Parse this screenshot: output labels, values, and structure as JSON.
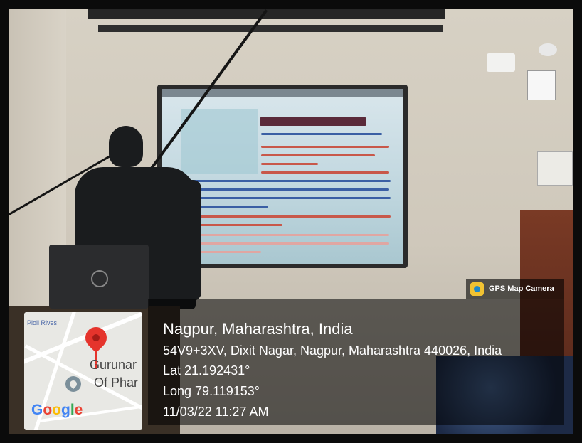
{
  "gps_badge": {
    "label": "GPS Map Camera",
    "icon": "gps-camera-icon"
  },
  "location": {
    "title": "Nagpur, Maharashtra, India",
    "address": "54V9+3XV, Dixit Nagar, Nagpur, Maharashtra 440026, India",
    "lat": "Lat 21.192431°",
    "long": "Long 79.119153°",
    "datetime": "11/03/22 11:27 AM"
  },
  "map": {
    "label_top": "Pioli Rives",
    "place_line1": "Gurunar",
    "place_line2": "Of Phar",
    "brand": [
      "G",
      "o",
      "o",
      "g",
      "l",
      "e"
    ],
    "brand_colors": [
      "#4285F4",
      "#EA4335",
      "#FBBC05",
      "#4285F4",
      "#34A853",
      "#EA4335"
    ],
    "pin_color": "#E5342C"
  },
  "colors": {
    "overlay": "#000000",
    "frame": "#0b0b0b"
  }
}
